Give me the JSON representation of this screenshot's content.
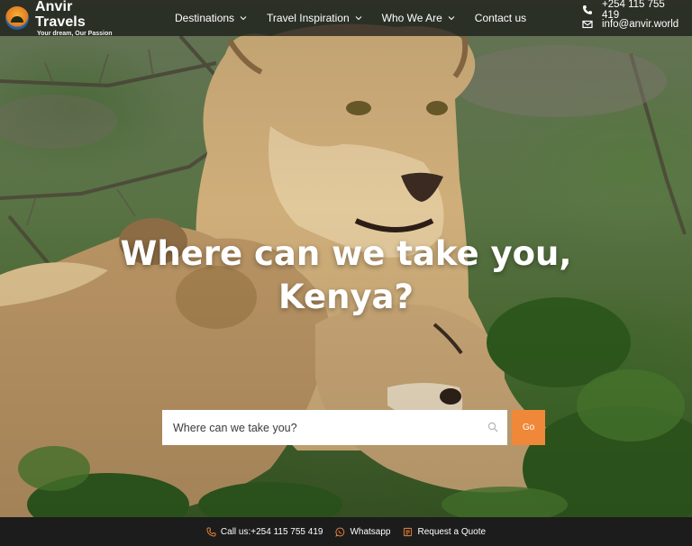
{
  "brand": {
    "name": "Anvir Travels",
    "tagline": "Your dream, Our Passion"
  },
  "nav": {
    "items": [
      {
        "label": "Destinations",
        "has_dropdown": true
      },
      {
        "label": "Travel Inspiration",
        "has_dropdown": true
      },
      {
        "label": "Who We Are",
        "has_dropdown": true
      },
      {
        "label": "Contact us",
        "has_dropdown": false
      }
    ]
  },
  "contact": {
    "phone": "+254 115 755 419",
    "email": "info@anvir.world",
    "phone_icon": "phone-icon",
    "email_icon": "envelope-icon"
  },
  "hero": {
    "headline_line1": "Where can we take you,",
    "headline_line2": "Kenya?"
  },
  "search": {
    "placeholder": "Where can we take you?",
    "value": "",
    "button_label": "Go",
    "icon": "search-icon"
  },
  "bottom_bar": {
    "call_label": "Call us:+254 115 755 419",
    "whatsapp_label": "Whatsapp",
    "quote_label": "Request a Quote",
    "call_icon": "phone-icon",
    "whatsapp_icon": "whatsapp-icon",
    "quote_icon": "document-icon"
  },
  "colors": {
    "accent": "#f0883a",
    "nav_background": "#161616",
    "bottom_bar_background": "#1c1c1c"
  }
}
